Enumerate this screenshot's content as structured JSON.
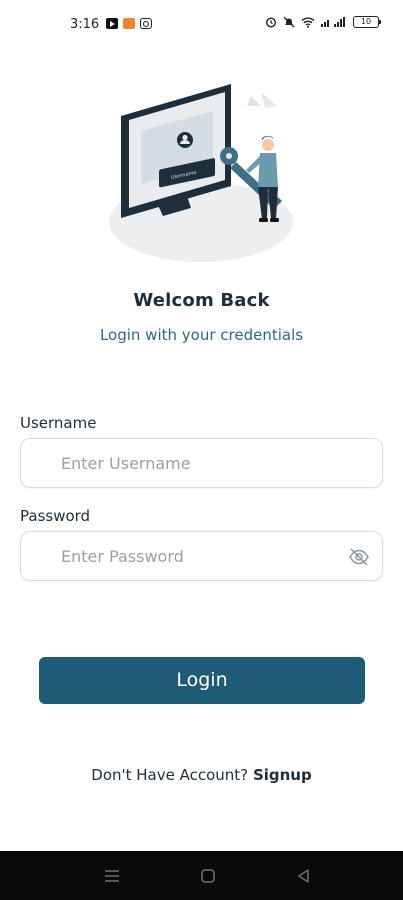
{
  "status_bar": {
    "time": "3:16",
    "battery": "10",
    "left_icons": [
      "youtube-icon",
      "app-notification-icon",
      "instagram-icon"
    ],
    "right_icons": [
      "alarm-icon",
      "mute-icon",
      "wifi-icon",
      "signal-icon",
      "battery-icon"
    ]
  },
  "login": {
    "title": "Welcom Back",
    "subtitle": "Login with your credentials",
    "username_label": "Username",
    "username_placeholder": "Enter Username",
    "password_label": "Password",
    "password_placeholder": "Enter Password",
    "login_button": "Login",
    "signup_prompt": "Don't Have Account?",
    "signup_link": "Signup"
  },
  "illustration": {
    "screen_label": "Username"
  },
  "colors": {
    "primary": "#1d5c74",
    "subtitle": "#2c6a80",
    "heading": "#1e2f3b",
    "nav_bar": "#0a0a0a"
  }
}
